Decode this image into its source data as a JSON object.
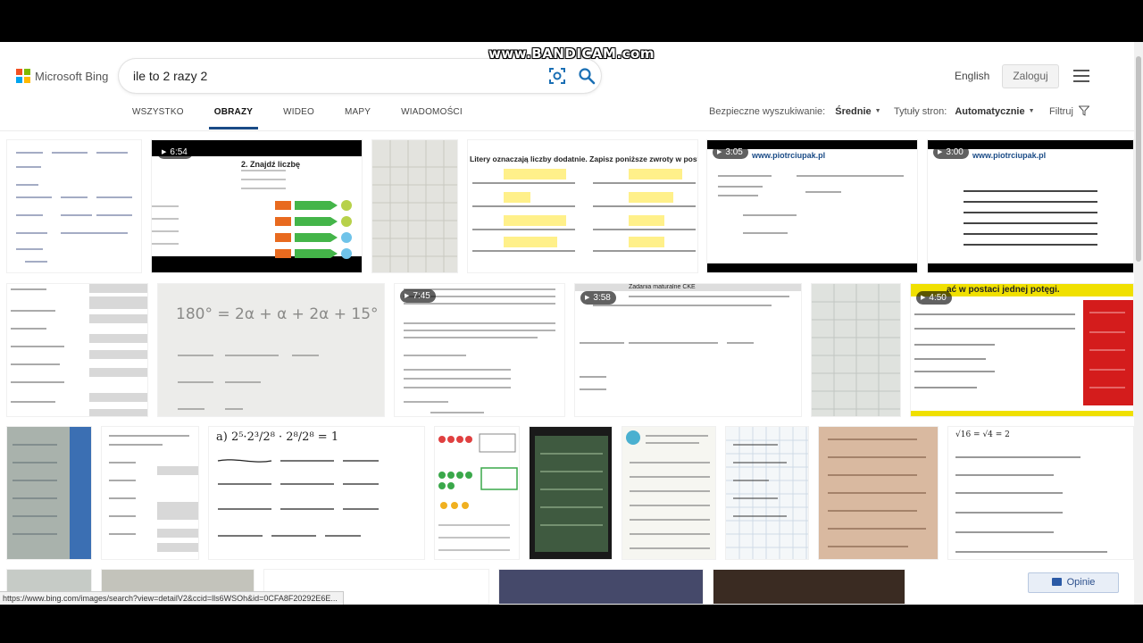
{
  "recorder": {
    "watermark": "www.BANDICAM.com"
  },
  "header": {
    "brand": "Microsoft Bing",
    "brand_colors": [
      "#f25022",
      "#7fba00",
      "#00a4ef",
      "#ffb900"
    ],
    "search_query": "ile to 2 razy 2",
    "language": "English",
    "login_label": "Zaloguj"
  },
  "nav": {
    "tabs": [
      {
        "label": "WSZYSTKO",
        "active": false
      },
      {
        "label": "OBRAZY",
        "active": true
      },
      {
        "label": "WIDEO",
        "active": false
      },
      {
        "label": "MAPY",
        "active": false
      },
      {
        "label": "WIADOMOŚCI",
        "active": false
      }
    ],
    "accent_color": "#1a4b86"
  },
  "filters": {
    "safe_search_label": "Bezpieczne wyszukiwanie:",
    "safe_search_value": "Średnie",
    "page_titles_label": "Tytuły stron:",
    "page_titles_value": "Automatycznie",
    "filter_label": "Filtruj"
  },
  "results": [
    {
      "duration": "",
      "caption": ""
    },
    {
      "duration": "6:54",
      "caption": "2. Znajdź liczbę"
    },
    {
      "duration": "",
      "caption": ""
    },
    {
      "duration": "",
      "caption": "Litery oznaczają liczby dodatnie. Zapisz poniższe zwroty w postaci wyrażeń algebra"
    },
    {
      "duration": "3:05",
      "caption": "www.piotrciupak.pl"
    },
    {
      "duration": "3:00",
      "caption": "www.piotrciupak.pl"
    },
    {
      "duration": "",
      "caption": ""
    },
    {
      "duration": "",
      "caption": "180° = 2α + α + 2α + 15°"
    },
    {
      "duration": "7:45",
      "caption": ""
    },
    {
      "duration": "3:58",
      "caption": "Zadania maturalne CKE"
    },
    {
      "duration": "",
      "caption": ""
    },
    {
      "duration": "4:50",
      "caption": "ać w postaci jednej potęgi."
    },
    {
      "duration": "",
      "caption": ""
    },
    {
      "duration": "",
      "caption": ""
    },
    {
      "duration": "",
      "caption": "a) 2⁵·2³/2⁸ · 2⁸/2⁸ = 1"
    },
    {
      "duration": "",
      "caption": ""
    },
    {
      "duration": "",
      "caption": ""
    },
    {
      "duration": "",
      "caption": ""
    },
    {
      "duration": "",
      "caption": ""
    },
    {
      "duration": "",
      "caption": ""
    },
    {
      "duration": "",
      "caption": "√16 = √4 = 2"
    }
  ],
  "status_bar": {
    "url": "https://www.bing.com/images/search?view=detailV2&ccid=lls6WSOh&id=0CFA8F20292E6E..."
  },
  "feedback": {
    "label": "Opinie"
  }
}
